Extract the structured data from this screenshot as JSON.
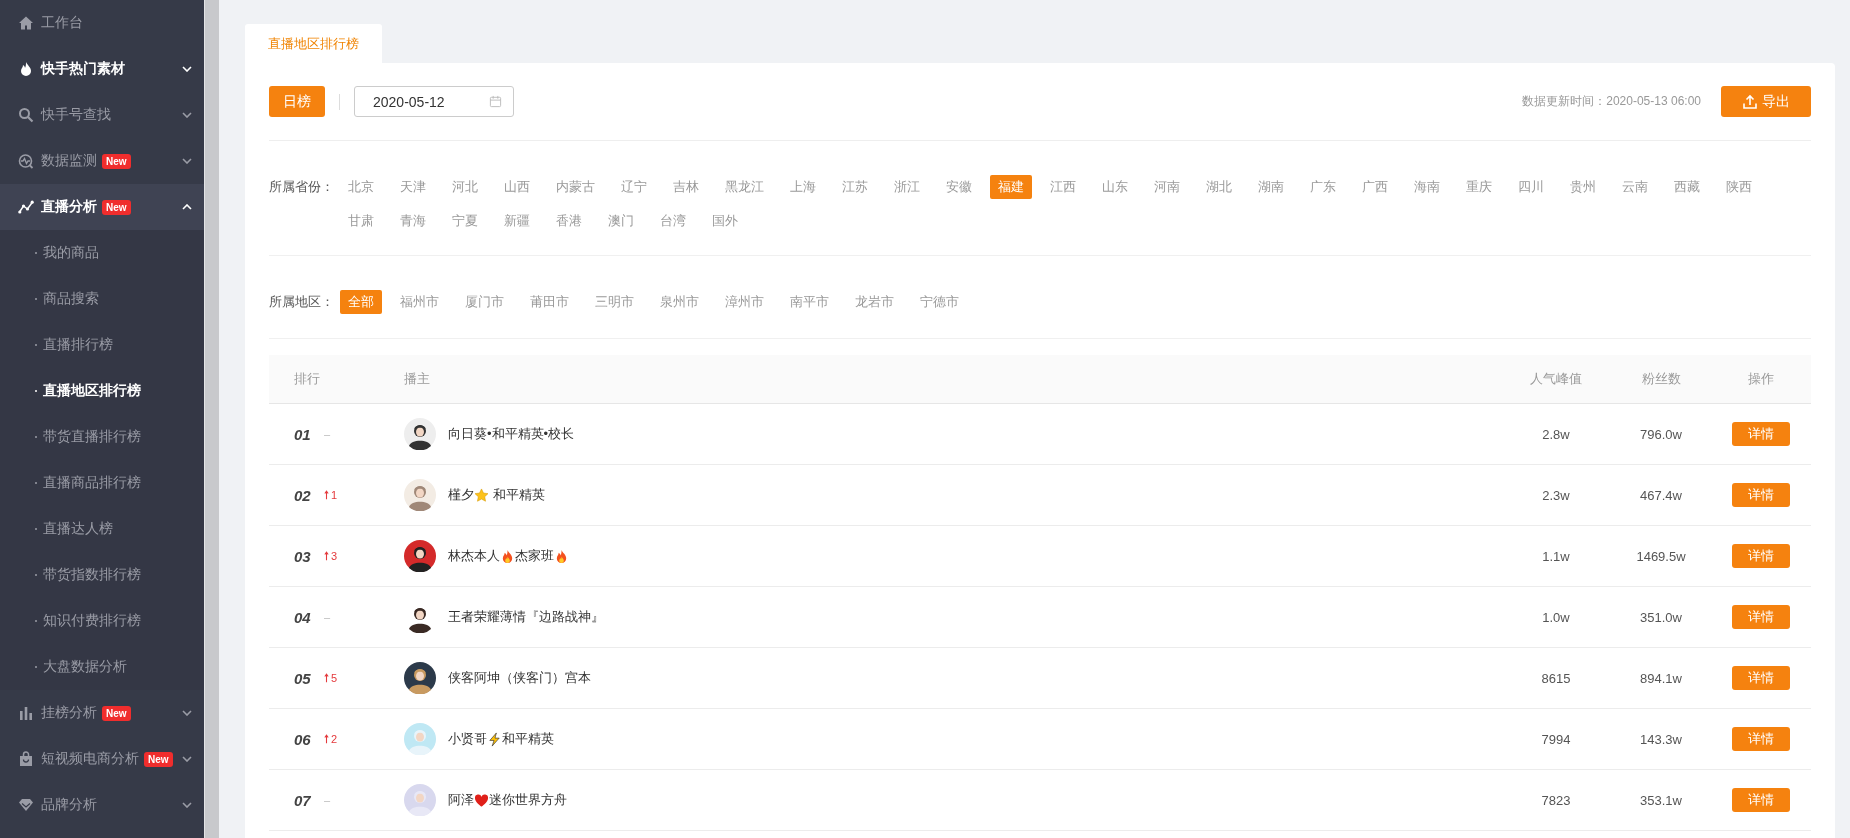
{
  "sidebar": {
    "items": [
      {
        "label": "工作台",
        "active": false
      },
      {
        "label": "快手热门素材",
        "active": true,
        "expanded": false
      },
      {
        "label": "快手号查找",
        "active": false,
        "expanded": false
      },
      {
        "label": "数据监测",
        "badge": "New",
        "active": false,
        "expanded": false
      },
      {
        "label": "直播分析",
        "badge": "New",
        "active": true,
        "expanded": true,
        "children": [
          {
            "label": "我的商品",
            "selected": false
          },
          {
            "label": "商品搜索",
            "selected": false
          },
          {
            "label": "直播排行榜",
            "selected": false
          },
          {
            "label": "直播地区排行榜",
            "selected": true
          },
          {
            "label": "带货直播排行榜",
            "selected": false
          },
          {
            "label": "直播商品排行榜",
            "selected": false
          },
          {
            "label": "直播达人榜",
            "selected": false
          },
          {
            "label": "带货指数排行榜",
            "selected": false
          },
          {
            "label": "知识付费排行榜",
            "selected": false
          },
          {
            "label": "大盘数据分析",
            "selected": false
          }
        ]
      },
      {
        "label": "挂榜分析",
        "badge": "New",
        "active": false,
        "expanded": false
      },
      {
        "label": "短视频电商分析",
        "badge": "New",
        "active": false,
        "expanded": false
      },
      {
        "label": "品牌分析",
        "active": false,
        "expanded": false
      }
    ]
  },
  "tabs": [
    {
      "label": "直播地区排行榜",
      "selected": true
    }
  ],
  "toolbar": {
    "period_button": "日榜",
    "date": "2020-05-12",
    "update_time": "数据更新时间：2020-05-13 06:00",
    "export_button": "导出"
  },
  "province_filter": {
    "label": "所属省份：",
    "options": [
      {
        "label": "北京",
        "selected": false
      },
      {
        "label": "天津",
        "selected": false
      },
      {
        "label": "河北",
        "selected": false
      },
      {
        "label": "山西",
        "selected": false
      },
      {
        "label": "内蒙古",
        "selected": false
      },
      {
        "label": "辽宁",
        "selected": false
      },
      {
        "label": "吉林",
        "selected": false
      },
      {
        "label": "黑龙江",
        "selected": false
      },
      {
        "label": "上海",
        "selected": false
      },
      {
        "label": "江苏",
        "selected": false
      },
      {
        "label": "浙江",
        "selected": false
      },
      {
        "label": "安徽",
        "selected": false
      },
      {
        "label": "福建",
        "selected": true
      },
      {
        "label": "江西",
        "selected": false
      },
      {
        "label": "山东",
        "selected": false
      },
      {
        "label": "河南",
        "selected": false
      },
      {
        "label": "湖北",
        "selected": false
      },
      {
        "label": "湖南",
        "selected": false
      },
      {
        "label": "广东",
        "selected": false
      },
      {
        "label": "广西",
        "selected": false
      },
      {
        "label": "海南",
        "selected": false
      },
      {
        "label": "重庆",
        "selected": false
      },
      {
        "label": "四川",
        "selected": false
      },
      {
        "label": "贵州",
        "selected": false
      },
      {
        "label": "云南",
        "selected": false
      },
      {
        "label": "西藏",
        "selected": false
      },
      {
        "label": "陕西",
        "selected": false
      },
      {
        "label": "甘肃",
        "selected": false
      },
      {
        "label": "青海",
        "selected": false
      },
      {
        "label": "宁夏",
        "selected": false
      },
      {
        "label": "新疆",
        "selected": false
      },
      {
        "label": "香港",
        "selected": false
      },
      {
        "label": "澳门",
        "selected": false
      },
      {
        "label": "台湾",
        "selected": false
      },
      {
        "label": "国外",
        "selected": false
      }
    ]
  },
  "region_filter": {
    "label": "所属地区：",
    "options": [
      {
        "label": "全部",
        "selected": true
      },
      {
        "label": "福州市",
        "selected": false
      },
      {
        "label": "厦门市",
        "selected": false
      },
      {
        "label": "莆田市",
        "selected": false
      },
      {
        "label": "三明市",
        "selected": false
      },
      {
        "label": "泉州市",
        "selected": false
      },
      {
        "label": "漳州市",
        "selected": false
      },
      {
        "label": "南平市",
        "selected": false
      },
      {
        "label": "龙岩市",
        "selected": false
      },
      {
        "label": "宁德市",
        "selected": false
      }
    ]
  },
  "table": {
    "columns": [
      "排行",
      "播主",
      "人气峰值",
      "粉丝数",
      "操作"
    ],
    "rows": [
      {
        "rank": "01",
        "change": {
          "kind": "same",
          "text": "–"
        },
        "streamer": [
          {
            "kind": "text",
            "text": "向日葵•和平精英•校长"
          }
        ],
        "peak": "2.8w",
        "fans": "796.0w",
        "action": "详情"
      },
      {
        "rank": "02",
        "change": {
          "kind": "up",
          "text": "1"
        },
        "streamer": [
          {
            "kind": "text",
            "text": "槿夕"
          },
          {
            "kind": "star"
          },
          {
            "kind": "text",
            "text": " 和平精英"
          }
        ],
        "peak": "2.3w",
        "fans": "467.4w",
        "action": "详情"
      },
      {
        "rank": "03",
        "change": {
          "kind": "up",
          "text": "3"
        },
        "streamer": [
          {
            "kind": "text",
            "text": "林杰本人"
          },
          {
            "kind": "flame"
          },
          {
            "kind": "text",
            "text": "杰家班"
          },
          {
            "kind": "flame"
          }
        ],
        "peak": "1.1w",
        "fans": "1469.5w",
        "action": "详情"
      },
      {
        "rank": "04",
        "change": {
          "kind": "same",
          "text": "–"
        },
        "streamer": [
          {
            "kind": "text",
            "text": "王者荣耀薄情『边路战神』"
          }
        ],
        "peak": "1.0w",
        "fans": "351.0w",
        "action": "详情"
      },
      {
        "rank": "05",
        "change": {
          "kind": "up",
          "text": "5"
        },
        "streamer": [
          {
            "kind": "text",
            "text": "侠客阿坤（侠客门）宫本"
          }
        ],
        "peak": "8615",
        "fans": "894.1w",
        "action": "详情"
      },
      {
        "rank": "06",
        "change": {
          "kind": "up",
          "text": "2"
        },
        "streamer": [
          {
            "kind": "text",
            "text": "小贤哥"
          },
          {
            "kind": "bolt"
          },
          {
            "kind": "text",
            "text": "和平精英"
          }
        ],
        "peak": "7994",
        "fans": "143.3w",
        "action": "详情"
      },
      {
        "rank": "07",
        "change": {
          "kind": "same",
          "text": "–"
        },
        "streamer": [
          {
            "kind": "text",
            "text": "阿泽"
          },
          {
            "kind": "heart"
          },
          {
            "kind": "text",
            "text": "迷你世界方舟"
          }
        ],
        "peak": "7823",
        "fans": "353.1w",
        "action": "详情"
      }
    ]
  }
}
